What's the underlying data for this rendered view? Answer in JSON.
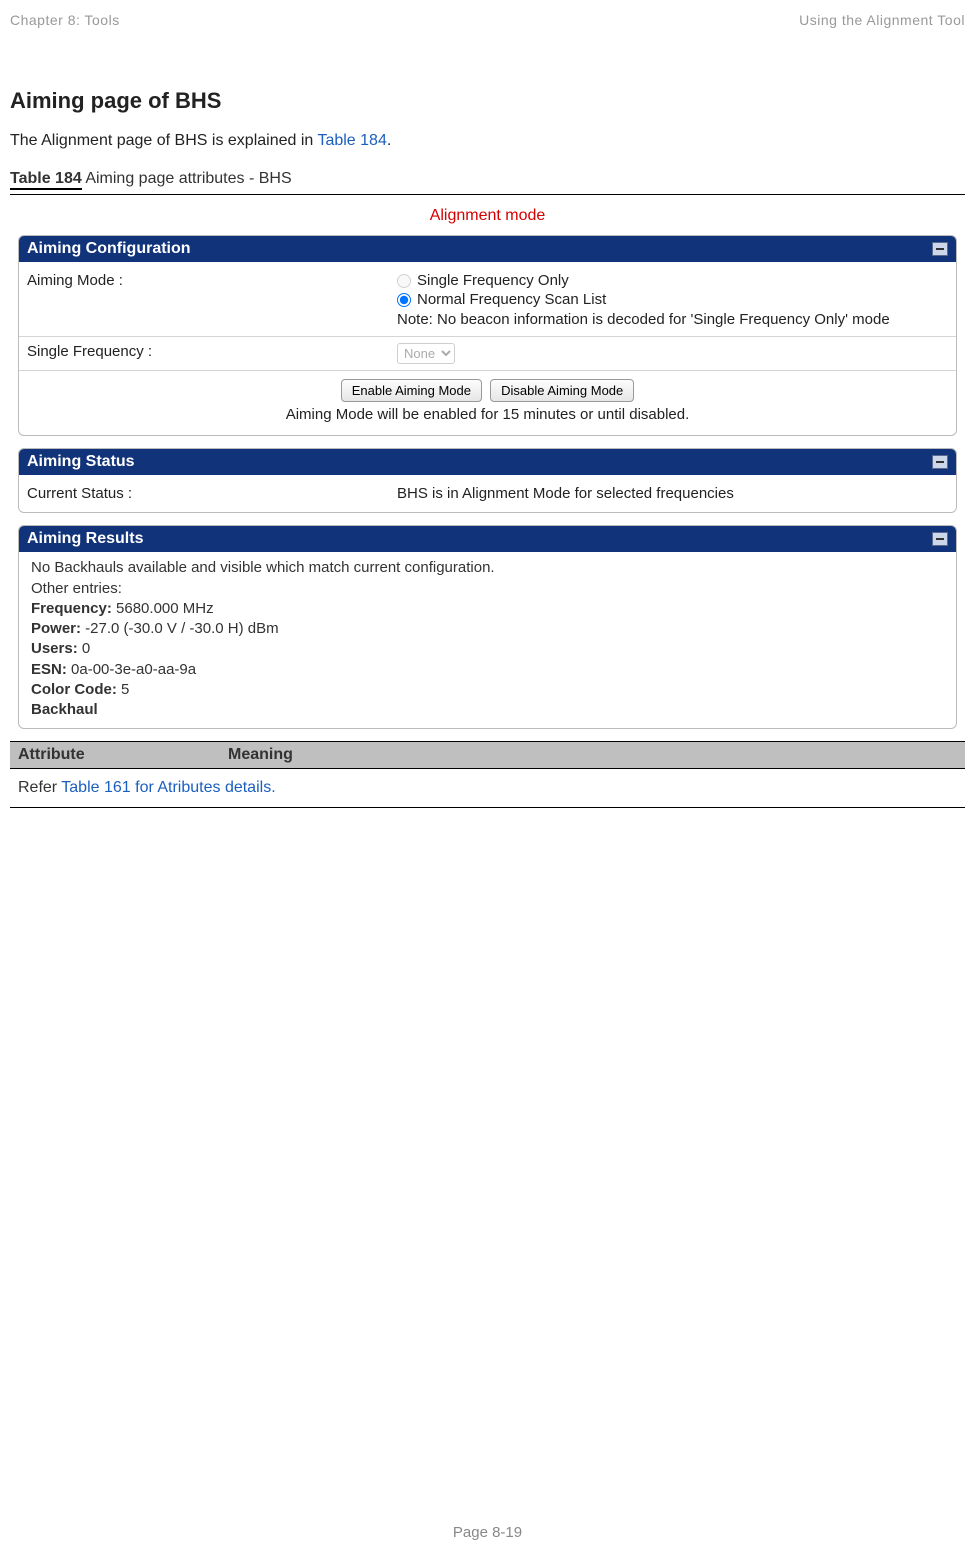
{
  "header": {
    "left": "Chapter 8:  Tools",
    "right": "Using the Alignment Tool"
  },
  "section": {
    "title": "Aiming page of BHS",
    "intro_prefix": "The Alignment page of BHS is explained in ",
    "intro_link": "Table 184",
    "intro_suffix": "."
  },
  "table_label": {
    "strong": "Table 184",
    "rest": " Aiming page attributes - BHS"
  },
  "mode_title": "Alignment mode",
  "panels": {
    "config": {
      "title": "Aiming Configuration",
      "aiming_mode_label": "Aiming Mode :",
      "radio1": "Single Frequency Only",
      "radio2": "Normal Frequency Scan List",
      "note": "Note: No beacon information is decoded for 'Single Frequency Only' mode",
      "single_freq_label": "Single Frequency :",
      "single_freq_value": "None",
      "btn_enable": "Enable Aiming Mode",
      "btn_disable": "Disable Aiming Mode",
      "sub_note": "Aiming Mode will be enabled for 15 minutes or until disabled."
    },
    "status": {
      "title": "Aiming Status",
      "label": "Current Status :",
      "value": "BHS is in Alignment Mode for selected frequencies"
    },
    "results": {
      "title": "Aiming Results",
      "line1": "No Backhauls available and visible which match current configuration.",
      "line2": "Other entries:",
      "freq_label": "Frequency:",
      "freq_value": " 5680.000 MHz",
      "power_label": "Power:",
      "power_value": " -27.0 (-30.0 V / -30.0 H) dBm",
      "users_label": "Users:",
      "users_value": " 0",
      "esn_label": "ESN:",
      "esn_value": " 0a-00-3e-a0-aa-9a",
      "cc_label": "Color Code:",
      "cc_value": " 5",
      "backhaul": "Backhaul"
    }
  },
  "attr_table": {
    "col_a": "Attribute",
    "col_b": "Meaning",
    "row_prefix": "Refer ",
    "row_link": "Table 161 for Atributes details."
  },
  "footer": "Page 8-19"
}
